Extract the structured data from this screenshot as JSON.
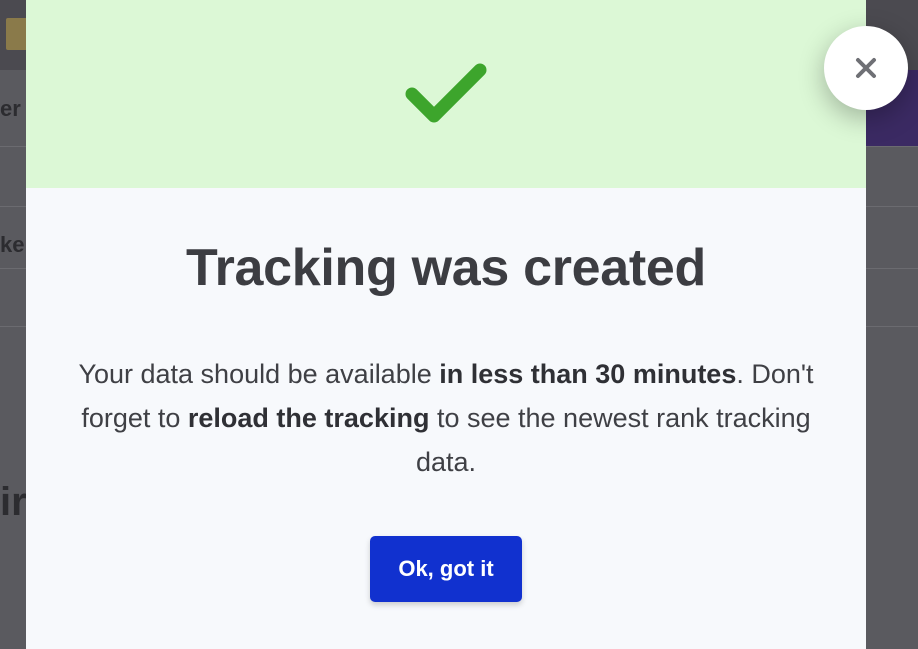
{
  "background": {
    "fragments": [
      "er",
      "ke",
      "ir"
    ]
  },
  "modal": {
    "title": "Tracking was created",
    "message": {
      "part1": "Your data should be available ",
      "bold1": "in less than 30 minutes",
      "part2": ". Don't forget to ",
      "bold2": "reload the tracking",
      "part3": " to see the newest rank tracking data."
    },
    "ok_button_label": "Ok, got it"
  },
  "colors": {
    "hero_background": "#dcf8d6",
    "check": "#3da52c",
    "primary_button": "#1131cf",
    "title_text": "#3c3d42"
  },
  "icons": {
    "success": "check-icon",
    "close": "close-icon"
  }
}
